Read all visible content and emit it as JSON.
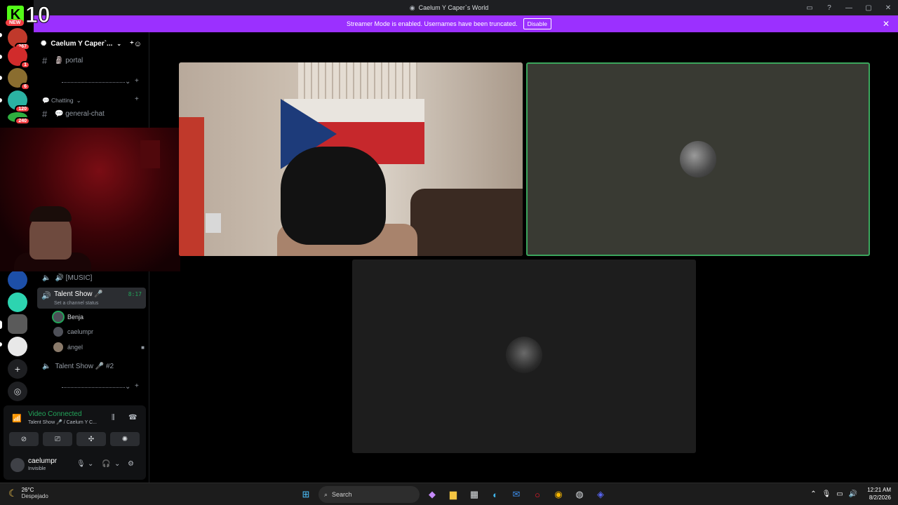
{
  "window": {
    "title": "Caelum Y Caper`s World",
    "controls": [
      "▭",
      "?",
      "—",
      "▢",
      "✕"
    ]
  },
  "banner": {
    "text": "Streamer Mode is enabled. Usernames have been truncated.",
    "button": "Disable"
  },
  "rail": {
    "kick_badge": "K",
    "kick_number": "10",
    "new_label": "NEW",
    "guild_counts": [
      "267",
      "1",
      "6",
      "120",
      "240"
    ]
  },
  "server": {
    "name": "Caelum Y Caper`...",
    "invite_icon": "add-person-icon"
  },
  "channels": {
    "portal": "🗿 portal",
    "category_chatting": "💬 Chatting",
    "general": "💬 general-chat",
    "music": "🔊 [MUSIC]",
    "talent_show": "Talent Show 🎤",
    "talent_status": "Set a channel status",
    "talent_timer": "8:17",
    "talent_show_2": "Talent Show 🎤 #2"
  },
  "members": [
    "Benja",
    "caelumpr",
    "ángel"
  ],
  "voice": {
    "connected": "Video Connected",
    "location": "Talent Show 🎤 / Caelum Y C...",
    "user": "caelumpr",
    "user_status": "Invisible"
  },
  "taskbar": {
    "temp": "26°C",
    "weather": "Despejado",
    "search": "Search",
    "time": "12:21 AM",
    "date": "8/2/2026"
  },
  "colors": {
    "accent": "#9b30ff",
    "green": "#23a55a",
    "banner_text": "#ffffff"
  }
}
